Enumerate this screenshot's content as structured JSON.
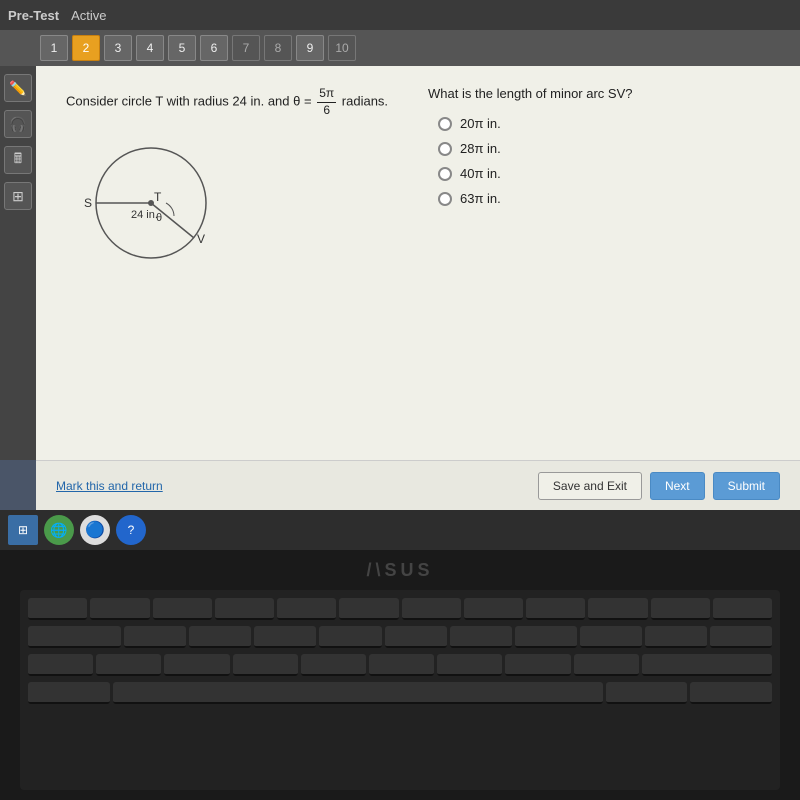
{
  "topBar": {
    "title": "Pre-Test",
    "status": "Active"
  },
  "navBar": {
    "buttons": [
      {
        "label": "1",
        "state": "normal"
      },
      {
        "label": "2",
        "state": "active"
      },
      {
        "label": "3",
        "state": "normal"
      },
      {
        "label": "4",
        "state": "normal"
      },
      {
        "label": "5",
        "state": "normal"
      },
      {
        "label": "6",
        "state": "normal"
      },
      {
        "label": "7",
        "state": "dimmed"
      },
      {
        "label": "8",
        "state": "dimmed"
      },
      {
        "label": "9",
        "state": "normal"
      },
      {
        "label": "10",
        "state": "dimmed"
      }
    ]
  },
  "question": {
    "leftText": "Consider circle T with radius 24 in. and θ =",
    "fraction": {
      "numerator": "5π",
      "denominator": "6"
    },
    "leftTextEnd": "radians.",
    "rightTitle": "What is the length of minor arc SV?",
    "diagram": {
      "radius": "24 in.",
      "center": "T",
      "pointS": "S",
      "pointV": "V",
      "angle": "θ"
    },
    "options": [
      {
        "label": "20π in.",
        "id": "opt1"
      },
      {
        "label": "28π in.",
        "id": "opt2"
      },
      {
        "label": "40π in.",
        "id": "opt3"
      },
      {
        "label": "63π in.",
        "id": "opt4"
      }
    ]
  },
  "bottomBar": {
    "markLink": "Mark this and return",
    "saveButton": "Save and Exit",
    "nextButton": "Next",
    "submitButton": "Submit"
  },
  "taskbar": {
    "icons": [
      "🪟",
      "🌐",
      "🔵"
    ]
  }
}
